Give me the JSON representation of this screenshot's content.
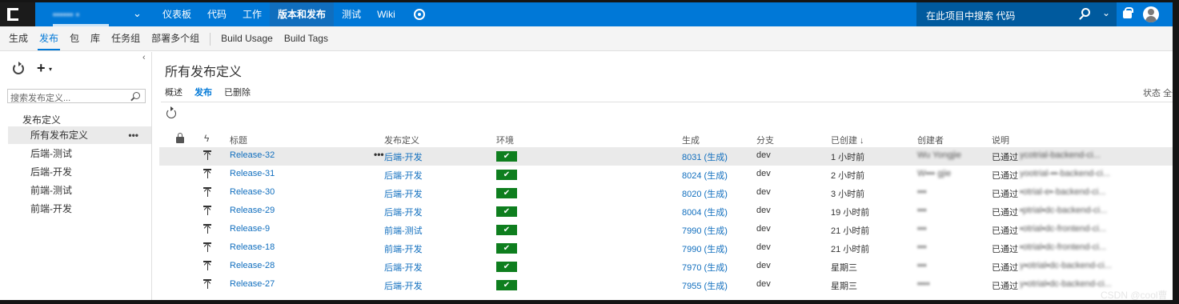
{
  "topbar": {
    "project_name": "▪▪▪▪▪▪ ▪",
    "project_caret": "⌄",
    "nav": [
      "仪表板",
      "代码",
      "工作",
      "版本和发布",
      "测试",
      "Wiki"
    ],
    "search_placeholder": "在此项目中搜索 代码",
    "search_caret": "⌄"
  },
  "subbar": {
    "tabs": [
      "生成",
      "发布",
      "包",
      "库",
      "任务组",
      "部署多个组"
    ],
    "tabs2": [
      "Build Usage",
      "Build Tags"
    ]
  },
  "left": {
    "collapse": "‹",
    "add_caret": "▾",
    "search_placeholder": "搜索发布定义...",
    "tree_head": "发布定义",
    "items": [
      "所有发布定义",
      "后端-测试",
      "后端-开发",
      "前端-测试",
      "前端-开发"
    ],
    "more": "•••"
  },
  "main": {
    "title": "所有发布定义",
    "pivots": [
      "概述",
      "发布",
      "已删除"
    ],
    "status_filter": "状态 全部",
    "columns": {
      "title": "标题",
      "definition": "发布定义",
      "environment": "环境",
      "build": "生成",
      "branch": "分支",
      "created": "已创建 ↓",
      "creator": "创建者",
      "description": "说明"
    },
    "bolt": "ϟ",
    "row_more": "•••",
    "env_check": "✔",
    "rows": [
      {
        "title": "Release-32",
        "definition": "后端-开发",
        "build": "8031 (生成)",
        "branch": "dev",
        "created": "1 小时前",
        "creator": "Wu Yongjie",
        "desc_prefix": "已通过",
        "desc_rest": "ycotrial-backend-ci...",
        "selected": true
      },
      {
        "title": "Release-31",
        "definition": "后端-开发",
        "build": "8024 (生成)",
        "branch": "dev",
        "created": "2 小时前",
        "creator": "W▪▪▪ gjie",
        "desc_prefix": "已通过",
        "desc_rest": "yootrial-▪▪-backend-ci...",
        "selected": false
      },
      {
        "title": "Release-30",
        "definition": "后端-开发",
        "build": "8020 (生成)",
        "branch": "dev",
        "created": "3 小时前",
        "creator": "▪▪▪",
        "desc_prefix": "已通过",
        "desc_rest": "▪otrial-e▪-backend-ci...",
        "selected": false
      },
      {
        "title": "Release-29",
        "definition": "后端-开发",
        "build": "8004 (生成)",
        "branch": "dev",
        "created": "19 小时前",
        "creator": "▪▪▪",
        "desc_prefix": "已通过",
        "desc_rest": "▪ptrial▪dc-backend-ci...",
        "selected": false
      },
      {
        "title": "Release-9",
        "definition": "前端-测试",
        "build": "7990 (生成)",
        "branch": "dev",
        "created": "21 小时前",
        "creator": "▪▪▪",
        "desc_prefix": "已通过",
        "desc_rest": "▪otrial▪dc-frontend-ci...",
        "selected": false
      },
      {
        "title": "Release-18",
        "definition": "前端-开发",
        "build": "7990 (生成)",
        "branch": "dev",
        "created": "21 小时前",
        "creator": "▪▪▪",
        "desc_prefix": "已通过",
        "desc_rest": "▪otrial▪dc-frontend-ci...",
        "selected": false
      },
      {
        "title": "Release-28",
        "definition": "后端-开发",
        "build": "7970 (生成)",
        "branch": "dev",
        "created": "星期三",
        "creator": "▪▪▪",
        "desc_prefix": "已通过",
        "desc_rest": "y▪otrial▪dc-backend-ci...",
        "selected": false
      },
      {
        "title": "Release-27",
        "definition": "后端-开发",
        "build": "7955 (生成)",
        "branch": "dev",
        "created": "星期三",
        "creator": "▪▪▪▪",
        "desc_prefix": "已通过",
        "desc_rest": "y▪otrial▪dc-backend-ci...",
        "selected": false
      }
    ]
  },
  "watermark": "CSDN @cool曹",
  "colors": {
    "accent": "#0078d7",
    "success": "#0e7e1e",
    "link": "#106ebe"
  }
}
